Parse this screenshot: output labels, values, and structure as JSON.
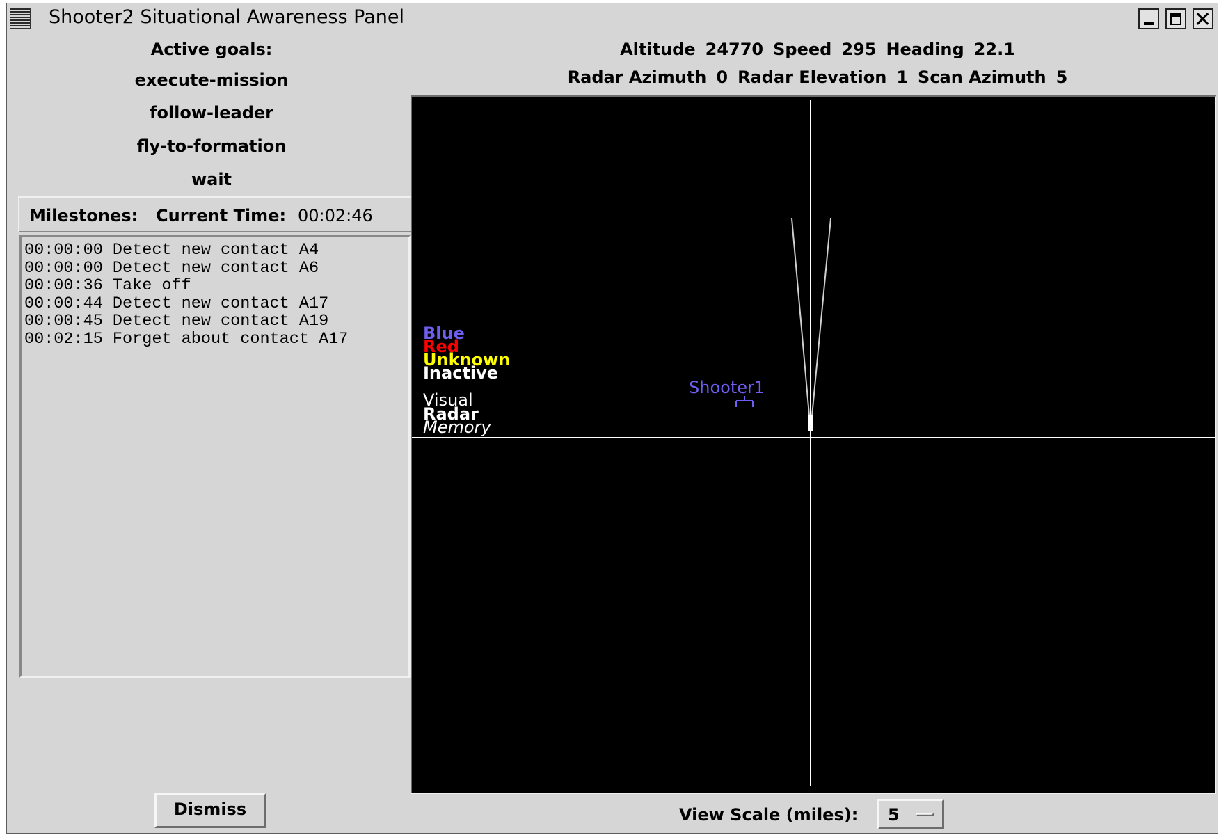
{
  "window": {
    "title": "Shooter2 Situational Awareness Panel"
  },
  "goals": {
    "label": "Active goals:",
    "items": [
      "execute-mission",
      "follow-leader",
      "fly-to-formation",
      "wait"
    ]
  },
  "milestones": {
    "label": "Milestones:",
    "time_label": "Current Time:",
    "current_time": "00:02:46",
    "log": [
      "00:00:00 Detect new contact A4",
      "00:00:00 Detect new contact A6",
      "00:00:36 Take off",
      "00:00:44 Detect new contact A17",
      "00:00:45 Detect new contact A19",
      "00:02:15 Forget about contact A17"
    ]
  },
  "status": {
    "altitude_label": "Altitude",
    "altitude": "24770",
    "speed_label": "Speed",
    "speed": "295",
    "heading_label": "Heading",
    "heading": "22.1",
    "radar_azimuth_label": "Radar Azimuth",
    "radar_azimuth": "0",
    "radar_elevation_label": "Radar Elevation",
    "radar_elevation": "1",
    "scan_azimuth_label": "Scan Azimuth",
    "scan_azimuth": "5"
  },
  "radar": {
    "legend": {
      "blue": "Blue",
      "red": "Red",
      "unknown": "Unknown",
      "inactive": "Inactive",
      "visual": "Visual",
      "radar": "Radar",
      "memory": "Memory"
    },
    "contact_label": "Shooter1",
    "colors": {
      "blue": "#6f5ff0",
      "red": "#ff0000",
      "unknown": "#ffff00",
      "inactive": "#ffffff"
    }
  },
  "controls": {
    "dismiss_label": "Dismiss",
    "view_scale_label": "View Scale (miles):",
    "view_scale_value": "5"
  },
  "icons": {
    "window_menu": "window-menu-icon",
    "minimize": "minimize-icon",
    "maximize": "maximize-icon",
    "close": "close-icon",
    "aircraft": "aircraft-icon"
  }
}
